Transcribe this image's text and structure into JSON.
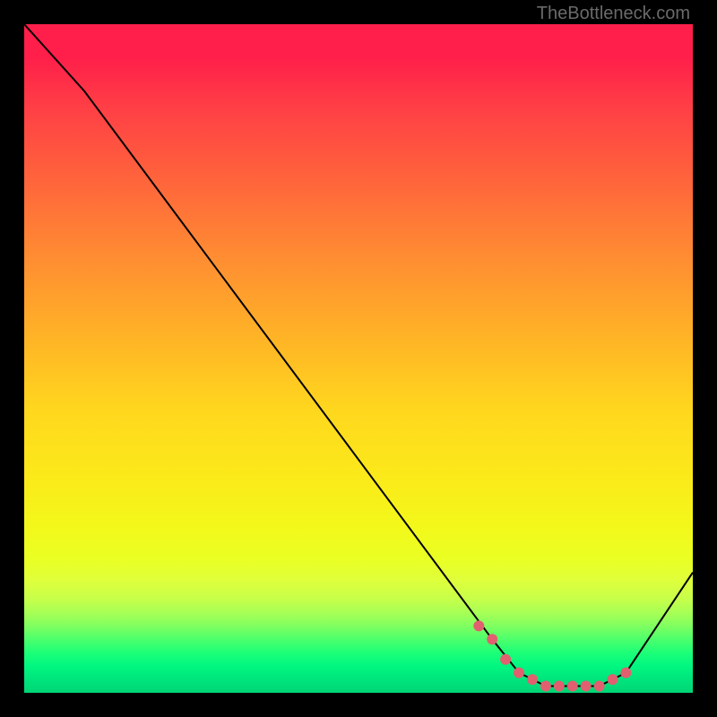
{
  "attribution": "TheBottleneck.com",
  "chart_data": {
    "type": "line",
    "title": "",
    "xlabel": "",
    "ylabel": "",
    "xlim": [
      0,
      100
    ],
    "ylim": [
      0,
      100
    ],
    "series": [
      {
        "name": "curve",
        "x": [
          0,
          9,
          70,
          74,
          78,
          82,
          86,
          90,
          100
        ],
        "values": [
          100,
          90,
          8,
          3,
          1,
          1,
          1,
          3,
          18
        ]
      },
      {
        "name": "highlight-dots",
        "x": [
          68,
          70,
          72,
          74,
          76,
          78,
          80,
          82,
          84,
          86,
          88,
          90
        ],
        "values": [
          10,
          8,
          5,
          3,
          2,
          1,
          1,
          1,
          1,
          1,
          2,
          3
        ]
      }
    ],
    "colors": {
      "curve": "#000000",
      "dots": "#e06070"
    }
  }
}
